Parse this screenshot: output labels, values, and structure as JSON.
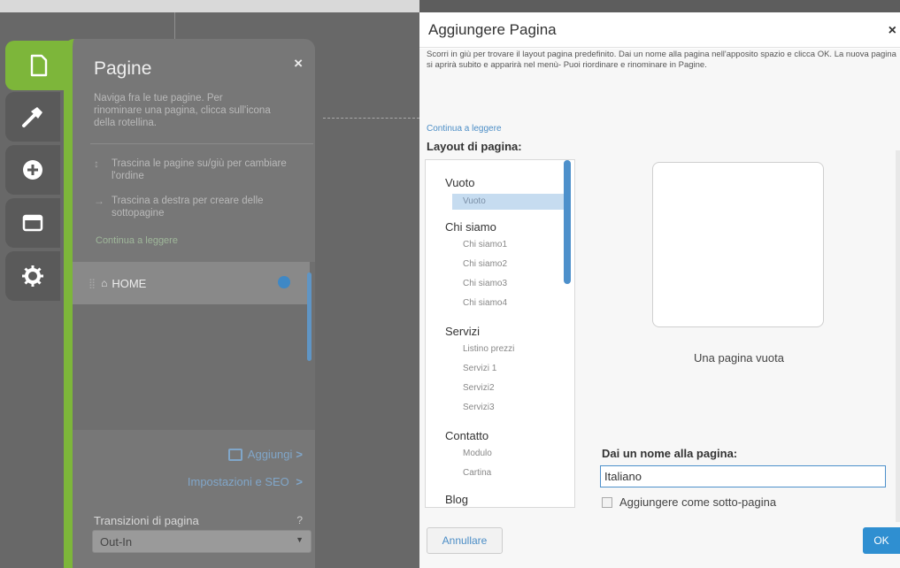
{
  "pagine_panel": {
    "title": "Pagine",
    "close": "×",
    "description": "Naviga fra le tue pagine. Per rinominare una pagina, clicca sull'icona della rotellina.",
    "hint_reorder": "Trascina le pagine su/giù per cambiare l'ordine",
    "hint_subpage": "Trascina a destra per creare delle sottopagine",
    "read_more": "Continua a leggere",
    "pages": [
      {
        "label": "HOME"
      }
    ],
    "add_label": "Aggiungi",
    "seo_label": "Impostazioni e SEO",
    "chevron": ">",
    "transitions_label": "Transizioni di pagina",
    "transitions_help": "?",
    "transitions_value": "Out-In"
  },
  "dialog": {
    "title": "Aggiungere Pagina",
    "close": "×",
    "intro": "Scorri in giù per trovare il layout pagina predefinito. Dai un nome alla pagina nell'apposito spazio e clicca OK. La nuova pagina si aprirà subito e apparirà nel menù- Puoi riordinare e rinominare in Pagine.",
    "read_more": "Continua a leggere",
    "layout_label": "Layout di pagina:",
    "layouts": {
      "vuoto": {
        "category": "Vuoto",
        "items": [
          "Vuoto"
        ]
      },
      "chi_siamo": {
        "category": "Chi siamo",
        "items": [
          "Chi siamo1",
          "Chi siamo2",
          "Chi siamo3",
          "Chi siamo4"
        ]
      },
      "servizi": {
        "category": "Servizi",
        "items": [
          "Listino prezzi",
          "Servizi 1",
          "Servizi2",
          "Servizi3"
        ]
      },
      "contatto": {
        "category": "Contatto",
        "items": [
          "Modulo",
          "Cartina"
        ]
      },
      "blog": {
        "category": "Blog"
      }
    },
    "preview_caption": "Una pagina vuota",
    "name_label": "Dai un nome alla pagina:",
    "name_value": "Italiano",
    "subpage_label": "Aggiungere come sotto-pagina",
    "cancel_label": "Annullare",
    "ok_label": "OK"
  },
  "colors": {
    "accent_green": "#7db63a",
    "accent_blue": "#2f8fd1"
  },
  "icons": [
    "page-icon",
    "hammer-icon",
    "plus-circle-icon",
    "layout-icon",
    "gear-icon",
    "home-icon",
    "drag-handle-icon",
    "add-page-icon"
  ]
}
